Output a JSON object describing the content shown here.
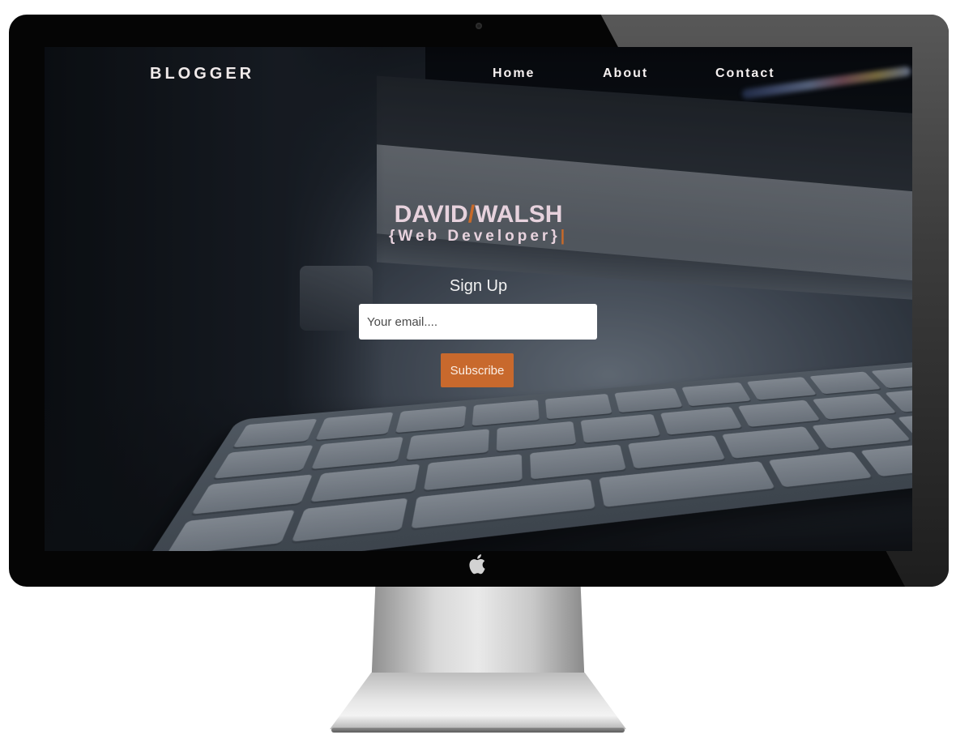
{
  "nav": {
    "brand": "BLOGGER",
    "links": [
      "Home",
      "About",
      "Contact"
    ]
  },
  "hero": {
    "first_name": "DAVID",
    "slash": "/",
    "last_name": "WALSH",
    "role": "{Web Developer}",
    "cursor": "|"
  },
  "signup": {
    "label": "Sign Up",
    "email_placeholder": "Your email....",
    "email_value": "",
    "button_label": "Subscribe"
  },
  "colors": {
    "accent": "#c8692d",
    "name_text": "#e7d2dd"
  },
  "icons": {
    "apple": "apple-logo-icon",
    "camera": "camera-icon"
  }
}
